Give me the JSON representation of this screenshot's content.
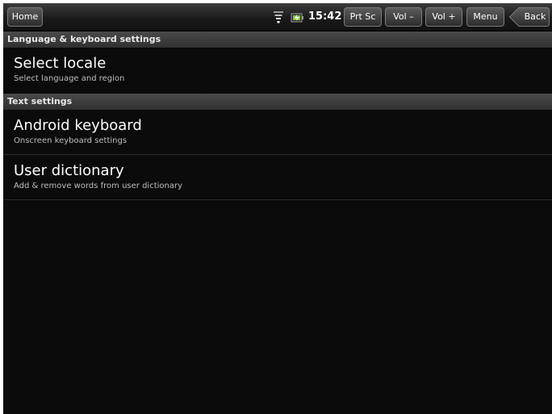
{
  "statusbar": {
    "home_label": "Home",
    "time": "15:42",
    "prtsc_label": "Prt Sc",
    "vol_down_label": "Vol –",
    "vol_up_label": "Vol +",
    "menu_label": "Menu",
    "back_label": "Back",
    "icons": [
      "wifi-icon",
      "battery-icon"
    ]
  },
  "sections": [
    {
      "header": "Language & keyboard settings",
      "items": [
        {
          "title": "Select locale",
          "summary": "Select language and region"
        }
      ]
    },
    {
      "header": "Text settings",
      "items": [
        {
          "title": "Android keyboard",
          "summary": "Onscreen keyboard settings"
        },
        {
          "title": "User dictionary",
          "summary": "Add & remove words from user dictionary"
        }
      ]
    }
  ],
  "colors": {
    "background": "#0b0b0b",
    "header_bg": "#3a3a3a",
    "title_text": "#ffffff",
    "summary_text": "#bdbdbd",
    "battery_accent": "#7ccf2c"
  }
}
